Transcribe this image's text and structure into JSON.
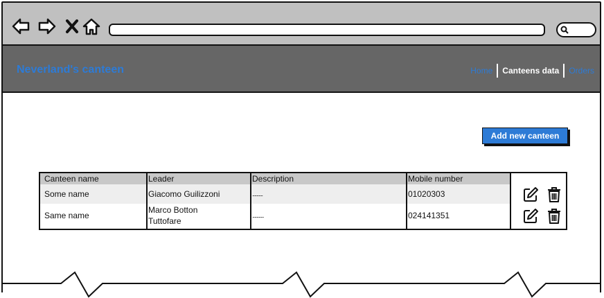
{
  "app": {
    "brand": "Neverland's canteen"
  },
  "nav": {
    "items": [
      {
        "label": "Home"
      },
      {
        "label": "Canteens data"
      },
      {
        "label": "Orders"
      }
    ]
  },
  "actions": {
    "add_label": "Add new canteen"
  },
  "table": {
    "columns": [
      "Canteen name",
      "Leader",
      "Description",
      "Mobile number"
    ],
    "rows": [
      {
        "name": "Some name",
        "leader": "Giacomo Guilizzoni",
        "leader_line2": "",
        "description": "..........",
        "mobile": "01020303"
      },
      {
        "name": "Same name",
        "leader": "Marco Botton",
        "leader_line2": "Tuttofare",
        "description": "...........",
        "mobile": "024141351"
      }
    ]
  },
  "colors": {
    "accent": "#2d7bd6",
    "header_bg": "#666666",
    "chrome_bg": "#c0c0c0"
  },
  "icons": [
    "back-arrow-icon",
    "forward-arrow-icon",
    "close-icon",
    "home-icon",
    "search-icon",
    "edit-icon",
    "trash-icon"
  ]
}
